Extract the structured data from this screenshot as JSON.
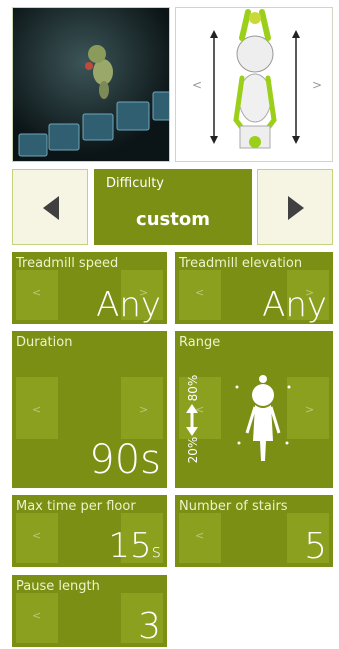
{
  "colors": {
    "tile": "#7a8f14",
    "tile_ghost": "#8ba01e",
    "arrow_button_bg": "#f6f4e3",
    "arrow_button_border": "#c6d27a"
  },
  "difficulty": {
    "label": "Difficulty",
    "value": "custom",
    "prev_icon": "triangle-left-icon",
    "next_icon": "triangle-right-icon"
  },
  "preview": {
    "left_chevron": "<",
    "right_chevron": ">"
  },
  "settings": {
    "treadmill_speed": {
      "title": "Treadmill speed",
      "value": "Any"
    },
    "treadmill_elevation": {
      "title": "Treadmill elevation",
      "value": "Any"
    },
    "duration": {
      "title": "Duration",
      "value": "90s"
    },
    "range": {
      "title": "Range",
      "low": "20%",
      "high": "80%"
    },
    "max_time_per_floor": {
      "title": "Max time per floor",
      "value": "15",
      "unit": "s"
    },
    "number_of_stairs": {
      "title": "Number of stairs",
      "value": "5"
    },
    "pause_length": {
      "title": "Pause length",
      "value": "3"
    }
  },
  "chevrons": {
    "left": "<",
    "right": ">"
  }
}
